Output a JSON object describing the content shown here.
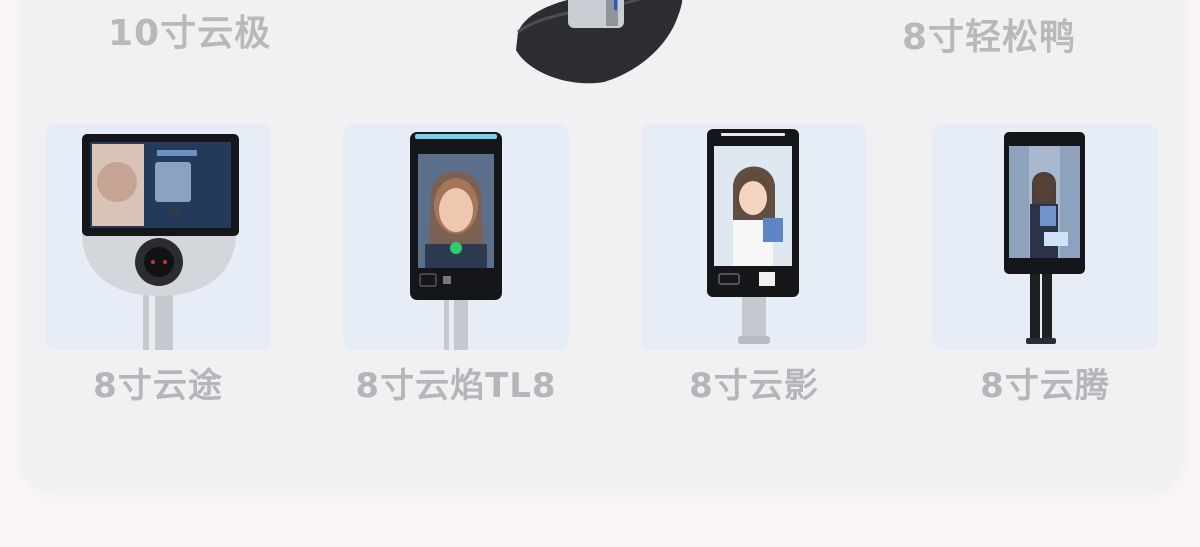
{
  "top_labels": {
    "left": "10寸云极",
    "right": "8寸轻松鸭"
  },
  "products": [
    {
      "name": "8寸云途"
    },
    {
      "name": "8寸云焰TL8"
    },
    {
      "name": "8寸云影"
    },
    {
      "name": "8寸云腾"
    }
  ],
  "colors": {
    "card_bg": "#e6edf7",
    "panel_bg": "#f1f1f3",
    "label": "#b6b6ba",
    "device_black": "#151619",
    "silver": "#c7ccd2"
  }
}
